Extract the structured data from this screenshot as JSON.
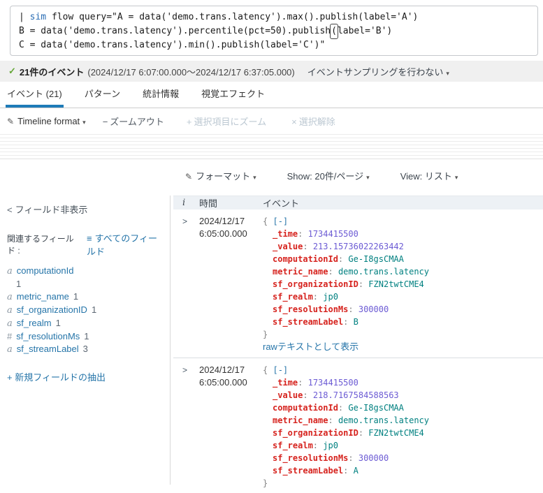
{
  "query": {
    "pipe": "| ",
    "command": "sim",
    "line1_rest": " flow query=\"A = data('demo.trans.latency').max().publish(label='A')",
    "line2_pre": "B = data('demo.trans.latency').percentile(pct=50).publish",
    "line2_cursor": "(",
    "line2_post": "label='B')",
    "line3": "C = data('demo.trans.latency').min().publish(label='C')\""
  },
  "event_bar": {
    "check_icon": "✓",
    "count": "21件のイベント",
    "range": "(2024/12/17 6:07:00.000〜2024/12/17 6:37:05.000)",
    "sampling": "イベントサンプリングを行わない",
    "caret": "▾"
  },
  "tabs": [
    {
      "label": "イベント (21)"
    },
    {
      "label": "パターン"
    },
    {
      "label": "統計情報"
    },
    {
      "label": "視覚エフェクト"
    }
  ],
  "timeline_toolbar": {
    "pencil_icon": "✎",
    "format_label": "Timeline format",
    "caret": "▾",
    "minus_icon": "−",
    "zoom_out": "ズームアウト",
    "plus_icon": "+",
    "zoom_selection": "選択項目にズーム",
    "close_icon": "×",
    "deselect": "選択解除"
  },
  "format_toolbar": {
    "pencil_icon": "✎",
    "format_label": "フォーマット",
    "show_label": "Show: 20件/ページ",
    "view_label": "View: リスト",
    "caret": "▾"
  },
  "sidebar": {
    "chevron_left": "<",
    "hide_fields": "フィールド非表示",
    "related_label": "関連するフィールド :",
    "list_icon": "≡",
    "all_fields": "すべてのフィールド",
    "fields": [
      {
        "prefix": "a",
        "name": "computationId",
        "count": "1"
      },
      {
        "prefix": "a",
        "name": "metric_name",
        "count": "1"
      },
      {
        "prefix": "a",
        "name": "sf_organizationID",
        "count": "1"
      },
      {
        "prefix": "a",
        "name": "sf_realm",
        "count": "1"
      },
      {
        "prefix": "#",
        "name": "sf_resolutionMs",
        "count": "1"
      },
      {
        "prefix": "a",
        "name": "sf_streamLabel",
        "count": "3"
      }
    ],
    "plus_icon": "+",
    "extract_fields": "新規フィールドの抽出"
  },
  "table": {
    "headers": {
      "info": "i",
      "time": "時間",
      "event": "イベント"
    },
    "expand_icon": ">"
  },
  "syntax": {
    "open": "{",
    "close": "}",
    "collapse": "[-]",
    "colon": ":"
  },
  "events": [
    {
      "date": "2024/12/17",
      "time": "6:05:00.000",
      "fields": [
        {
          "key": "_time",
          "value": "1734415500"
        },
        {
          "key": "_value",
          "value": "213.15736022263442"
        },
        {
          "key": "computationId",
          "value": "Ge-I8gsCMAA"
        },
        {
          "key": "metric_name",
          "value": "demo.trans.latency"
        },
        {
          "key": "sf_organizationID",
          "value": "FZN2twtCME4"
        },
        {
          "key": "sf_realm",
          "value": "jp0"
        },
        {
          "key": "sf_resolutionMs",
          "value": "300000"
        },
        {
          "key": "sf_streamLabel",
          "value": "B"
        }
      ],
      "raw_link": "rawテキストとして表示"
    },
    {
      "date": "2024/12/17",
      "time": "6:05:00.000",
      "fields": [
        {
          "key": "_time",
          "value": "1734415500"
        },
        {
          "key": "_value",
          "value": "218.7167584588563"
        },
        {
          "key": "computationId",
          "value": "Ge-I8gsCMAA"
        },
        {
          "key": "metric_name",
          "value": "demo.trans.latency"
        },
        {
          "key": "sf_organizationID",
          "value": "FZN2twtCME4"
        },
        {
          "key": "sf_realm",
          "value": "jp0"
        },
        {
          "key": "sf_resolutionMs",
          "value": "300000"
        },
        {
          "key": "sf_streamLabel",
          "value": "A"
        }
      ]
    }
  ],
  "colors": {
    "accent_blue": "#1e7bb8",
    "link_blue": "#2675a9",
    "check_green": "#65a637",
    "json_key_red": "#d6231e",
    "json_number_purple": "#6c5bd4",
    "json_string_teal": "#008080"
  }
}
